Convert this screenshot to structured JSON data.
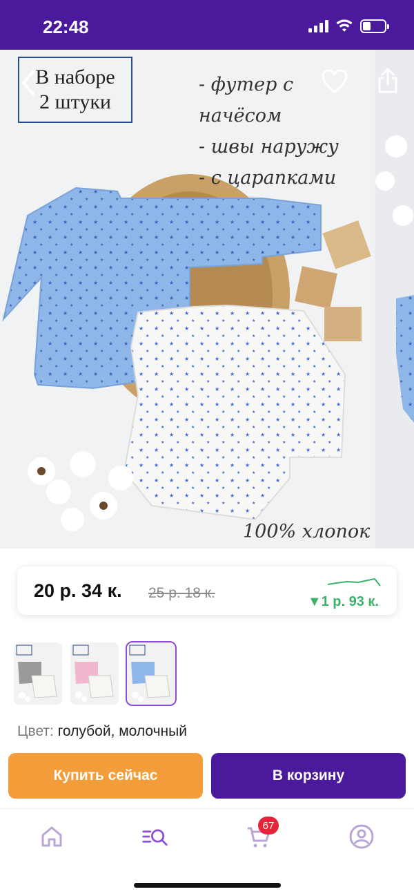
{
  "status_bar": {
    "time": "22:48",
    "battery_level": 0.35
  },
  "gallery": {
    "set_label_line1": "В наборе",
    "set_label_line2": "2 штуки",
    "features": [
      "- футер с начёсом",
      "- швы наружу",
      "- с царапками"
    ],
    "cotton_label": "100% хлопок"
  },
  "price": {
    "current": "20 р.  34 к.",
    "old": "25 р.  18 к.",
    "change": "▼1 р.  93 к.",
    "trend_color": "#3bb16a"
  },
  "variants": {
    "selected_index": 2,
    "count": 3
  },
  "color": {
    "label": "Цвет:",
    "value": "голубой, молочный"
  },
  "actions": {
    "buy_now": "Купить сейчас",
    "add_to_cart": "В корзину"
  },
  "tabbar": {
    "cart_badge": "67"
  },
  "colors": {
    "brand": "#4b1a9c",
    "accent": "#f39c3a",
    "selected_tab": "#8d4cd9",
    "badge": "#e5243b"
  }
}
